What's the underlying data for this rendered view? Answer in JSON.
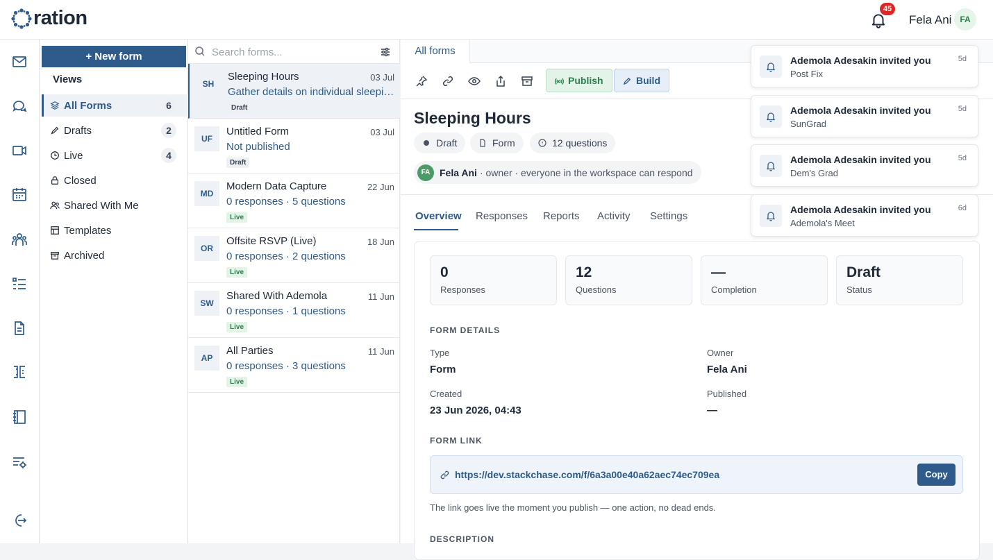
{
  "app": {
    "logo_text": "ration",
    "user_name": "Fela Ani",
    "user_initials": "FA",
    "notification_count": "45"
  },
  "rail": {
    "icons": [
      "mail-icon",
      "chat-icon",
      "video-icon",
      "calendar-icon",
      "people-icon",
      "list-icon",
      "document-icon",
      "book-split-icon",
      "notebook-icon",
      "list-settings-icon",
      "logout-icon"
    ]
  },
  "views": {
    "new_form_label": "New form",
    "title": "Views",
    "items": [
      {
        "label": "All Forms",
        "count": "6"
      },
      {
        "label": "Drafts",
        "count": "2"
      },
      {
        "label": "Live",
        "count": "4"
      },
      {
        "label": "Closed"
      },
      {
        "label": "Shared With Me"
      },
      {
        "label": "Templates"
      },
      {
        "label": "Archived"
      }
    ]
  },
  "forms_list": {
    "search_placeholder": "Search forms...",
    "items": [
      {
        "initials": "SH",
        "title": "Sleeping Hours",
        "date": "03 Jul",
        "subtitle": "Gather details on individual sleeping patterns",
        "tag": "Draft"
      },
      {
        "initials": "UF",
        "title": "Untitled Form",
        "date": "03 Jul",
        "subtitle": "Not published",
        "tag": "Draft"
      },
      {
        "initials": "MD",
        "title": "Modern Data Capture",
        "date": "22 Jun",
        "subtitle": "0 responses · 5 questions",
        "tag": "Live"
      },
      {
        "initials": "OR",
        "title": "Offsite RSVP (Live)",
        "date": "18 Jun",
        "subtitle": "0 responses · 2 questions",
        "tag": "Live"
      },
      {
        "initials": "SW",
        "title": "Shared With Ademola",
        "date": "11 Jun",
        "subtitle": "0 responses · 1 questions",
        "tag": "Live"
      },
      {
        "initials": "AP",
        "title": "All Parties",
        "date": "11 Jun",
        "subtitle": "0 responses · 3 questions",
        "tag": "Live"
      }
    ]
  },
  "main": {
    "tab_label": "All forms",
    "publish_label": "Publish",
    "build_label": "Build",
    "form_title": "Sleeping Hours",
    "chips": {
      "status": "Draft",
      "type": "Form",
      "questions": "12 questions"
    },
    "owner": {
      "initials": "FA",
      "name": "Fela Ani",
      "note": "· owner · everyone in the workspace can respond"
    },
    "nav_tabs": [
      "Overview",
      "Responses",
      "Reports",
      "Activity",
      "Settings"
    ],
    "stats": [
      {
        "value": "0",
        "label": "Responses"
      },
      {
        "value": "12",
        "label": "Questions"
      },
      {
        "value": "—",
        "label": "Completion"
      },
      {
        "value": "Draft",
        "label": "Status"
      }
    ],
    "details_heading": "FORM DETAILS",
    "details": {
      "type_label": "Type",
      "type_value": "Form",
      "owner_label": "Owner",
      "owner_value": "Fela Ani",
      "created_label": "Created",
      "created_value": "23 Jun 2026, 04:43",
      "published_label": "Published",
      "published_value": "—"
    },
    "link_heading": "FORM LINK",
    "link_url": "https://dev.stackchase.com/f/6a3a00e40a62aec74ec709ea",
    "copy_label": "Copy",
    "link_note": "The link goes live the moment you publish — one action, no dead ends.",
    "description_heading": "DESCRIPTION"
  },
  "notifications": [
    {
      "title": "Ademola Adesakin invited you",
      "subtitle": "Post Fix",
      "age": "5d"
    },
    {
      "title": "Ademola Adesakin invited you",
      "subtitle": "SunGrad",
      "age": "5d"
    },
    {
      "title": "Ademola Adesakin invited you",
      "subtitle": "Dem's Grad",
      "age": "5d"
    },
    {
      "title": "Ademola Adesakin invited you",
      "subtitle": "Ademola's Meet",
      "age": "6d"
    }
  ],
  "colors": {
    "accent": "#2f5b8a",
    "live": "#2e7d4f",
    "badge": "#dc2626"
  }
}
